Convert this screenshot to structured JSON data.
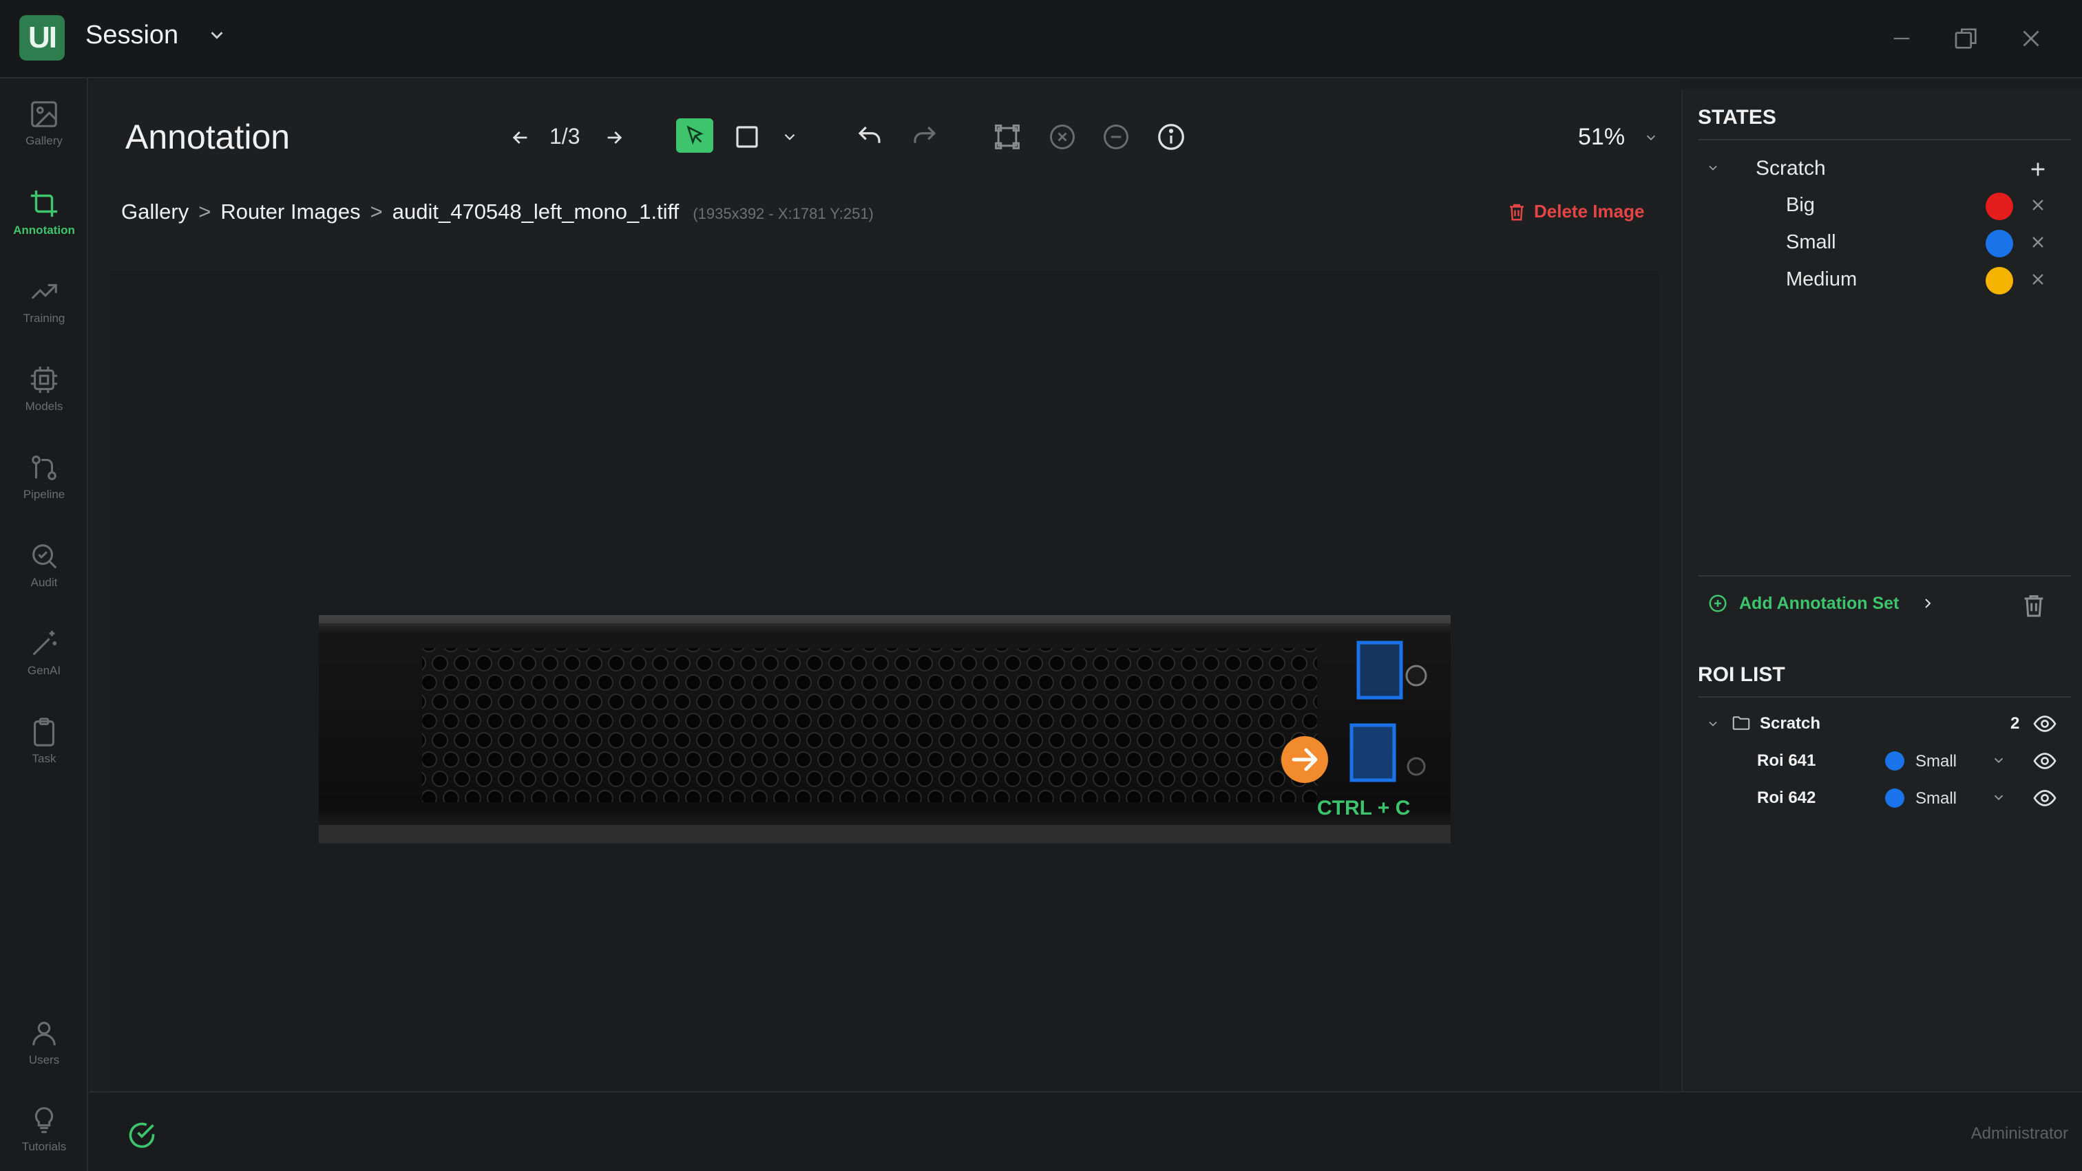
{
  "titlebar": {
    "logo_text": "UI",
    "session_label": "Session",
    "icons": [
      "chevron-down-icon",
      "minimize-icon",
      "restore-icon",
      "close-icon"
    ]
  },
  "nav": {
    "items": [
      {
        "label": "Gallery",
        "icon": "image-icon",
        "active": false
      },
      {
        "label": "Annotation",
        "icon": "crop-icon",
        "active": true
      },
      {
        "label": "Training",
        "icon": "trend-icon",
        "active": false
      },
      {
        "label": "Models",
        "icon": "chip-icon",
        "active": false
      },
      {
        "label": "Pipeline",
        "icon": "pipeline-icon",
        "active": false
      },
      {
        "label": "Audit",
        "icon": "search-check-icon",
        "active": false
      },
      {
        "label": "GenAI",
        "icon": "wand-icon",
        "active": false
      },
      {
        "label": "Task",
        "icon": "clipboard-icon",
        "active": false
      }
    ],
    "bottom_items": [
      {
        "label": "Users",
        "icon": "user-icon"
      },
      {
        "label": "Tutorials",
        "icon": "bulb-icon"
      }
    ]
  },
  "toolbar": {
    "page_title": "Annotation",
    "pager": "1/3",
    "zoom": "51%",
    "accent_color": "#3ec46d",
    "icons": [
      "arrow-left-icon",
      "arrow-right-icon",
      "select-cursor-icon",
      "rectangle-icon",
      "chevron-down-icon",
      "undo-icon",
      "redo-icon",
      "bounding-box-icon",
      "clear-circle-icon",
      "minus-circle-icon",
      "info-icon"
    ]
  },
  "breadcrumb": {
    "items": [
      "Gallery",
      "Router Images",
      "audit_470548_left_mono_1.tiff"
    ],
    "separator": ">",
    "meta": "(1935x392 - X:1781 Y:251)"
  },
  "delete_image_label": "Delete Image",
  "canvas": {
    "tooltip_text": "CTRL + C",
    "roi_color": "#1a73e8",
    "cursor_color": "#f28a2e"
  },
  "states": {
    "title": "STATES",
    "group": "Scratch",
    "items": [
      {
        "name": "Big",
        "color": "#e51c1c"
      },
      {
        "name": "Small",
        "color": "#1a73e8"
      },
      {
        "name": "Medium",
        "color": "#f5b400"
      }
    ],
    "add_set_label": "Add Annotation Set"
  },
  "roi_list": {
    "title": "ROI LIST",
    "group": "Scratch",
    "count": "2",
    "items": [
      {
        "name": "Roi 641",
        "state": "Small",
        "color": "#1a73e8"
      },
      {
        "name": "Roi 642",
        "state": "Small",
        "color": "#1a73e8"
      }
    ]
  },
  "statusbar": {
    "user": "Administrator"
  }
}
